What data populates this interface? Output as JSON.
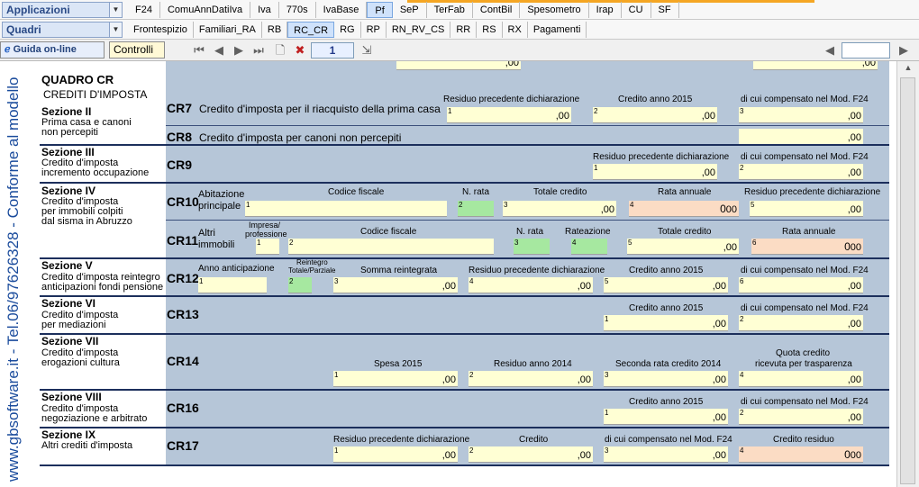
{
  "top": {
    "combo1": "Applicazioni",
    "combo2": "Quadri",
    "tabs1": [
      "F24",
      "ComuAnnDatiIva",
      "Iva",
      "770s",
      "IvaBase",
      "Pf",
      "SeP",
      "TerFab",
      "ContBil",
      "Spesometro",
      "Irap",
      "CU",
      "SF"
    ],
    "tabs2": [
      "Frontespizio",
      "Familiari_RA",
      "RB",
      "RC_CR",
      "RG",
      "RP",
      "RN_RV_CS",
      "RR",
      "RS",
      "RX",
      "Pagamenti"
    ]
  },
  "toolbar": {
    "guida": "Guida on-line",
    "controlli": "Controlli",
    "page": "1"
  },
  "side_text": "www.gbsoftware.it - Tel.06/97626328 - Conforme al modello",
  "form": {
    "title": "QUADRO CR",
    "subtitle": "CREDITI D'IMPOSTA",
    "top_vals": [
      ",00",
      ",00"
    ],
    "s2": {
      "title": "Sezione II",
      "desc1": "Prima casa e canoni",
      "desc2": "non percepiti"
    },
    "cr7": {
      "code": "CR7",
      "desc": "Credito d'imposta per il riacquisto della prima casa",
      "h1": "Residuo precedente dichiarazione",
      "h2": "Credito anno 2015",
      "h3": "di cui compensato nel Mod. F24",
      "v1": ",00",
      "v2": ",00",
      "v3": ",00"
    },
    "cr8": {
      "code": "CR8",
      "desc": "Credito d'imposta per canoni non percepiti",
      "v1": ",00"
    },
    "s3": {
      "title": "Sezione III",
      "desc1": "Credito d'imposta",
      "desc2": "incremento occupazione"
    },
    "cr9": {
      "code": "CR9",
      "h1": "Residuo precedente dichiarazione",
      "h2": "di cui compensato nel Mod. F24",
      "v1": ",00",
      "v2": ",00"
    },
    "s4": {
      "title": "Sezione IV",
      "desc1": "Credito d'imposta",
      "desc2": "per immobili colpiti",
      "desc3": "dal sisma in Abruzzo"
    },
    "cr10": {
      "code": "CR10",
      "lab1": "Abitazione",
      "lab2": "principale",
      "h1": "Codice fiscale",
      "h2": "N. rata",
      "h3": "Totale credito",
      "h4": "Rata annuale",
      "h5": "Residuo precedente dichiarazione",
      "v3": ",00",
      "v4a": "0",
      "v4b": "00",
      "v5": ",00"
    },
    "cr11": {
      "code": "CR11",
      "lab1": "Altri",
      "lab2": "immobili",
      "h1a": "Impresa/",
      "h1b": "professione",
      "h2": "Codice fiscale",
      "h3": "N. rata",
      "h4": "Rateazione",
      "h5": "Totale credito",
      "h6": "Rata annuale",
      "v5": ",00",
      "v6a": "0",
      "v6b": "00"
    },
    "s5": {
      "title": "Sezione V",
      "desc1": "Credito d'imposta reintegro",
      "desc2": "anticipazioni fondi pensione"
    },
    "cr12": {
      "code": "CR12",
      "h1": "Anno anticipazione",
      "h2a": "Reintegro",
      "h2b": "Totale/Parziale",
      "h3": "Somma reintegrata",
      "h4": "Residuo precedente dichiarazione",
      "h5": "Credito anno 2015",
      "h6": "di cui compensato nel Mod. F24",
      "v3": ",00",
      "v4": ",00",
      "v5": ",00",
      "v6": ",00"
    },
    "s6": {
      "title": "Sezione VI",
      "desc1": "Credito d'imposta",
      "desc2": "per mediazioni"
    },
    "cr13": {
      "code": "CR13",
      "h1": "Credito anno 2015",
      "h2": "di cui compensato nel Mod. F24",
      "v1": ",00",
      "v2": ",00"
    },
    "s7": {
      "title": "Sezione VII",
      "desc1": "Credito d'imposta",
      "desc2": "erogazioni cultura"
    },
    "cr14": {
      "code": "CR14",
      "h1": "Spesa 2015",
      "h2": "Residuo anno 2014",
      "h3": "Seconda rata credito 2014",
      "h4a": "Quota credito",
      "h4b": "ricevuta per trasparenza",
      "v1": ",00",
      "v2": ",00",
      "v3": ",00",
      "v4": ",00"
    },
    "s8": {
      "title": "Sezione VIII",
      "desc1": "Credito d'imposta",
      "desc2": "negoziazione e arbitrato"
    },
    "cr16": {
      "code": "CR16",
      "h1": "Credito anno 2015",
      "h2": "di cui compensato nel Mod. F24",
      "v1": ",00",
      "v2": ",00"
    },
    "s9": {
      "title": "Sezione IX",
      "desc1": "Altri crediti d'imposta"
    },
    "cr17": {
      "code": "CR17",
      "h1": "Residuo precedente dichiarazione",
      "h2": "Credito",
      "h3": "di cui compensato nel Mod. F24",
      "h4": "Credito residuo",
      "v1": ",00",
      "v2": ",00",
      "v3": ",00",
      "v4a": "0",
      "v4b": "00"
    }
  }
}
